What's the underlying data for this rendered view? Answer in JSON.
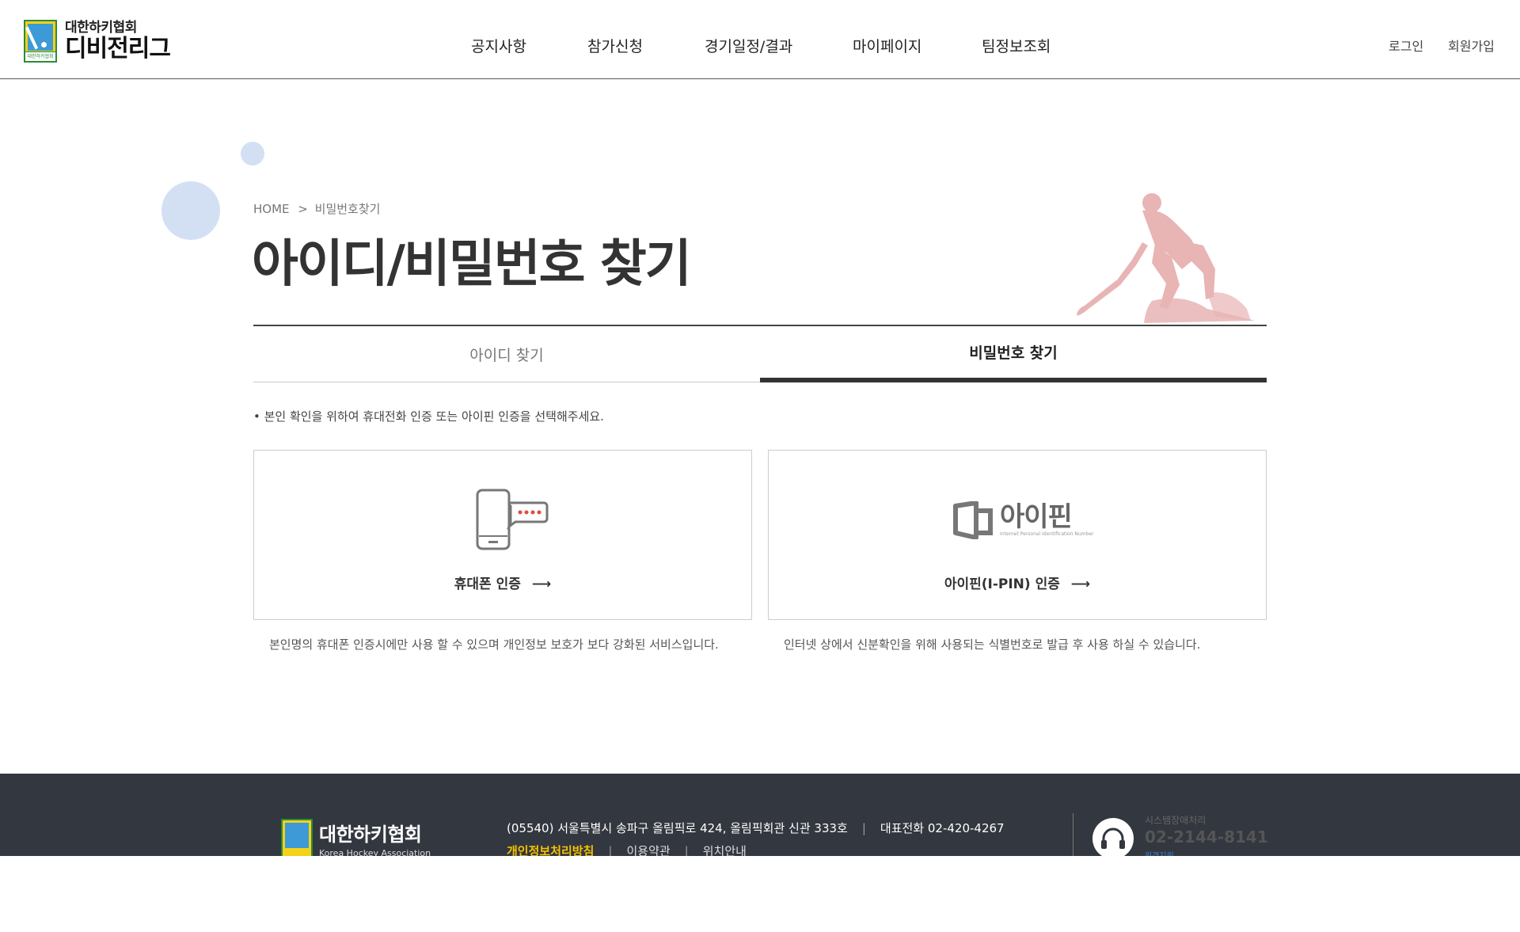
{
  "header": {
    "logo_top": "대한하키협회",
    "logo_main": "디비전리그",
    "logo_badge": "대한하키협회",
    "nav": [
      "공지사항",
      "참가신청",
      "경기일정/결과",
      "마이페이지",
      "팀정보조회"
    ],
    "login": "로그인",
    "signup": "회원가입"
  },
  "page": {
    "breadcrumb_home": "HOME",
    "breadcrumb_sep": ">",
    "breadcrumb_current": "비밀번호찾기",
    "title": "아이디/비밀번호 찾기"
  },
  "tabs": [
    {
      "label": "아이디 찾기",
      "active": false
    },
    {
      "label": "비밀번호 찾기",
      "active": true
    }
  ],
  "notice": "• 본인 확인을 위하여 휴대전화 인증 또는 아이핀 인증을 선택해주세요.",
  "cards": [
    {
      "label": "휴대폰 인증",
      "icon": "phone-icon",
      "description": "본인명의 휴대폰 인증시에만 사용 할 수 있으며 개인정보 보호가 보다 강화된 서비스입니다."
    },
    {
      "label": "아이핀(I-PIN) 인증",
      "icon": "ipin-logo",
      "logo_text": "아이핀",
      "logo_sub": "Internet Personal Identification Number",
      "description": "인터넷 상에서 신분확인을 위해 사용되는 식별번호로 발급 후 사용 하실 수 있습니다."
    }
  ],
  "footer": {
    "org_ko": "대한하키협회",
    "org_en": "Korea Hockey Association",
    "address": "(05540) 서울특별시 송파구 올림픽로 424, 올림픽회관 신관 333호",
    "phone": "대표전화 02-420-4267",
    "links": [
      "개인정보처리방침",
      "이용약관",
      "위치안내"
    ],
    "help_label": "시스템장애처리",
    "help_phone": "02-2144-8141",
    "help_sub": "원격지원"
  },
  "colors": {
    "accent_yellow": "#f3c200",
    "footer_bg": "#33373f",
    "circle": "#d3e0f4",
    "player": "#e8b4b4"
  }
}
